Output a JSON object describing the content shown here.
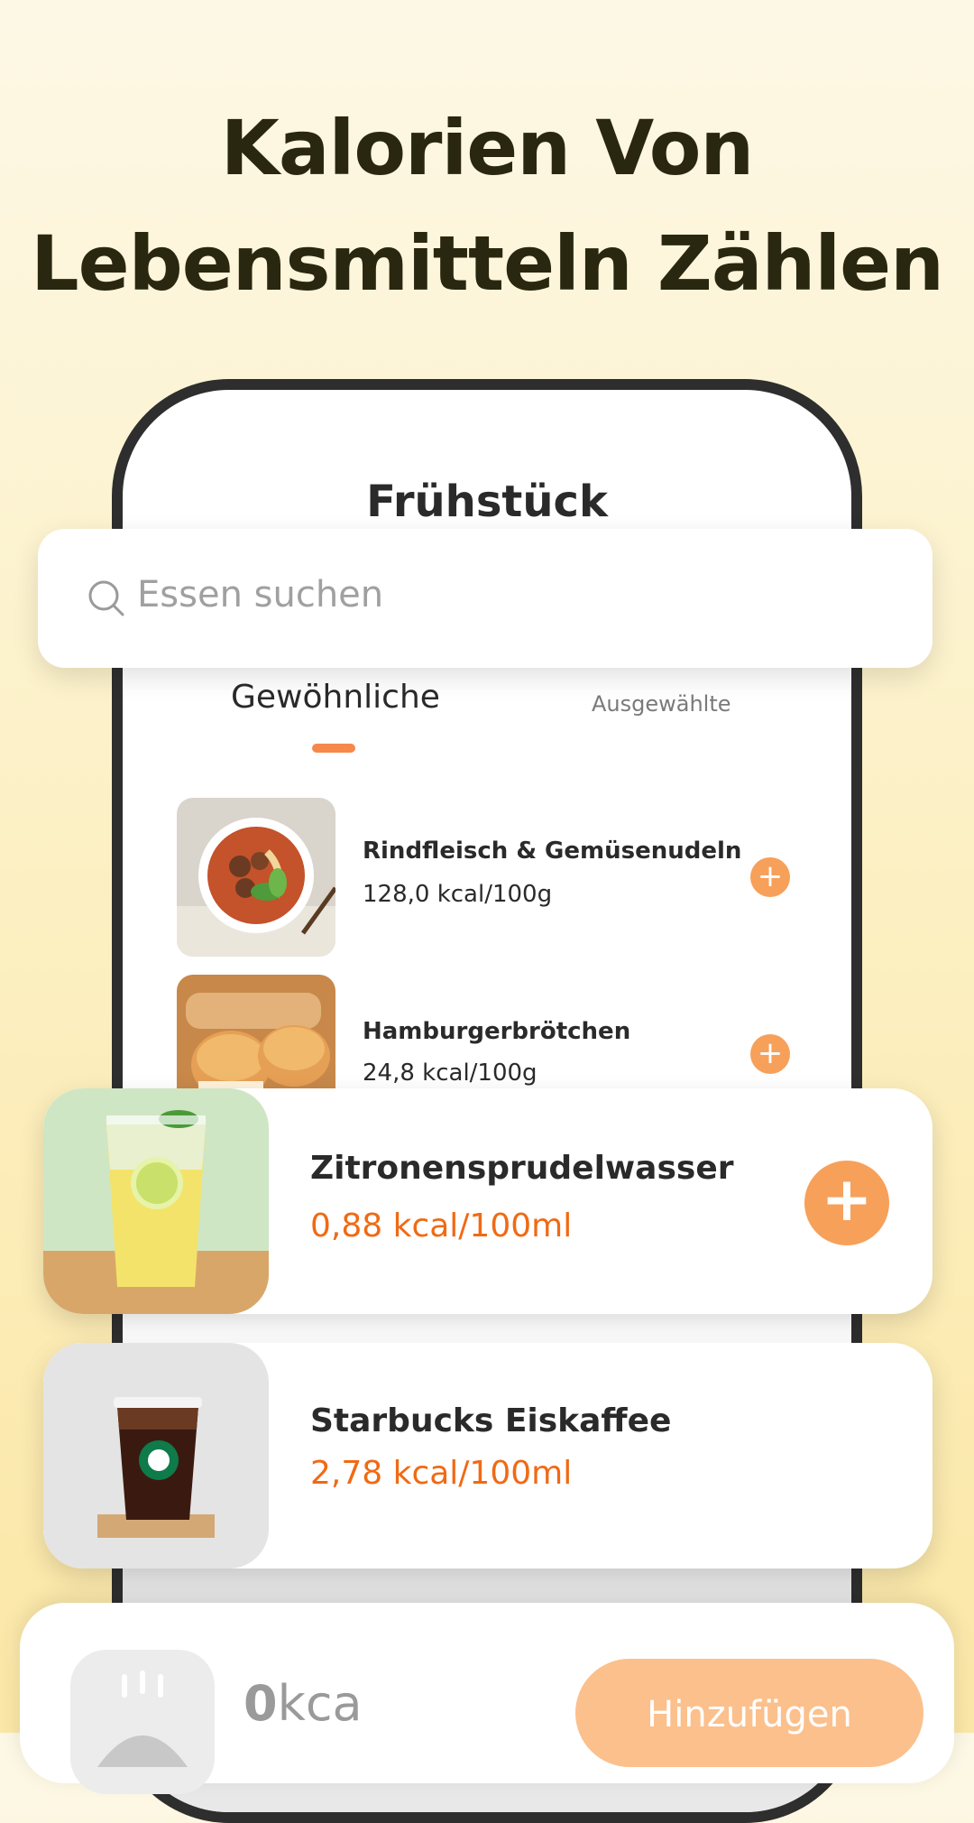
{
  "headline": {
    "line1": "Kalorien Von",
    "line2": "Lebensmitteln Zählen"
  },
  "phone": {
    "title": "Frühstück",
    "tabs": [
      {
        "label": "Gewöhnliche",
        "active": true
      },
      {
        "label": "Ausgewählte",
        "active": false
      }
    ],
    "foods": [
      {
        "name": "Rindfleisch & Gemüsenudeln",
        "kcal": "128,0 kcal/100g",
        "icon": "plus-icon"
      },
      {
        "name": "Hamburgerbrötchen",
        "kcal": "24,8 kcal/100g",
        "icon": "plus-icon"
      }
    ]
  },
  "search": {
    "placeholder": "Essen suchen",
    "icon": "search-icon"
  },
  "cards": [
    {
      "name": "Zitronensprudelwasser",
      "kcal": "0,88 kcal/100ml",
      "icon": "plus-icon"
    },
    {
      "name": "Starbucks Eiskaffee",
      "kcal": "2,78 kcal/100ml"
    }
  ],
  "bottom": {
    "kcal_value": "0",
    "kcal_unit": "kca",
    "add_label": "Hinzufügen"
  },
  "colors": {
    "accent": "#f7a05a",
    "kcal_text": "#f06a14",
    "headline": "#2a2710"
  }
}
